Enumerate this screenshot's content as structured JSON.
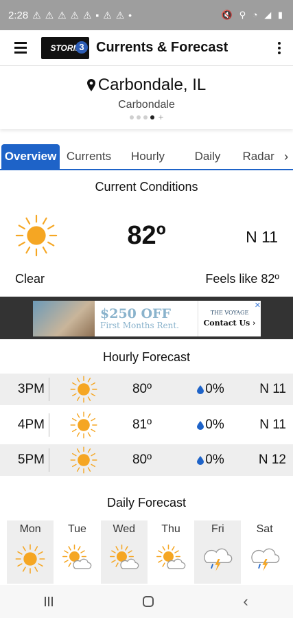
{
  "status_bar": {
    "time": "2:28",
    "notifications": "⚠ ⚠ ⚠ ⚠ ⚠ ▪ ⚠ ⚠ •",
    "system_icons": "🔇 ⚲ ◔ ◢ ▮"
  },
  "app_bar": {
    "logo_text": "STORM",
    "logo_number": "3",
    "title": "Currents & Forecast"
  },
  "location": {
    "name": "Carbondale, IL",
    "subtitle": "Carbondale",
    "page_dots": 4,
    "active_dot": 3,
    "add_symbol": "+"
  },
  "tabs": [
    {
      "label": "Overview",
      "active": true
    },
    {
      "label": "Currents",
      "active": false
    },
    {
      "label": "Hourly",
      "active": false
    },
    {
      "label": "Daily",
      "active": false
    },
    {
      "label": "Radar",
      "active": false
    }
  ],
  "tab_next": "›",
  "current": {
    "title": "Current Conditions",
    "icon": "sun-icon",
    "temp": "82º",
    "wind": "N  11",
    "description": "Clear",
    "feels_like": "Feels like 82º"
  },
  "ad": {
    "headline": "$250 OFF",
    "subline": "First Months Rent.",
    "brand": "THE VOYAGE",
    "cta": "Contact Us ›",
    "close": "✕"
  },
  "hourly": {
    "title": "Hourly Forecast",
    "rows": [
      {
        "time": "3PM",
        "icon": "sun-icon",
        "temp": "80º",
        "precip": "0%",
        "wind": "N 11"
      },
      {
        "time": "4PM",
        "icon": "sun-icon",
        "temp": "81º",
        "precip": "0%",
        "wind": "N 11"
      },
      {
        "time": "5PM",
        "icon": "sun-icon",
        "temp": "80º",
        "precip": "0%",
        "wind": "N 12"
      }
    ]
  },
  "daily": {
    "title": "Daily Forecast",
    "days": [
      {
        "label": "Mon",
        "icon": "sun-icon"
      },
      {
        "label": "Tue",
        "icon": "partly-cloudy-icon"
      },
      {
        "label": "Wed",
        "icon": "partly-cloudy-icon"
      },
      {
        "label": "Thu",
        "icon": "partly-cloudy-icon"
      },
      {
        "label": "Fri",
        "icon": "thunderstorm-icon"
      },
      {
        "label": "Sat",
        "icon": "thunderstorm-icon"
      }
    ]
  },
  "colors": {
    "accent": "#1e63c8",
    "sun": "#f5a623",
    "drop": "#1e63c8"
  }
}
